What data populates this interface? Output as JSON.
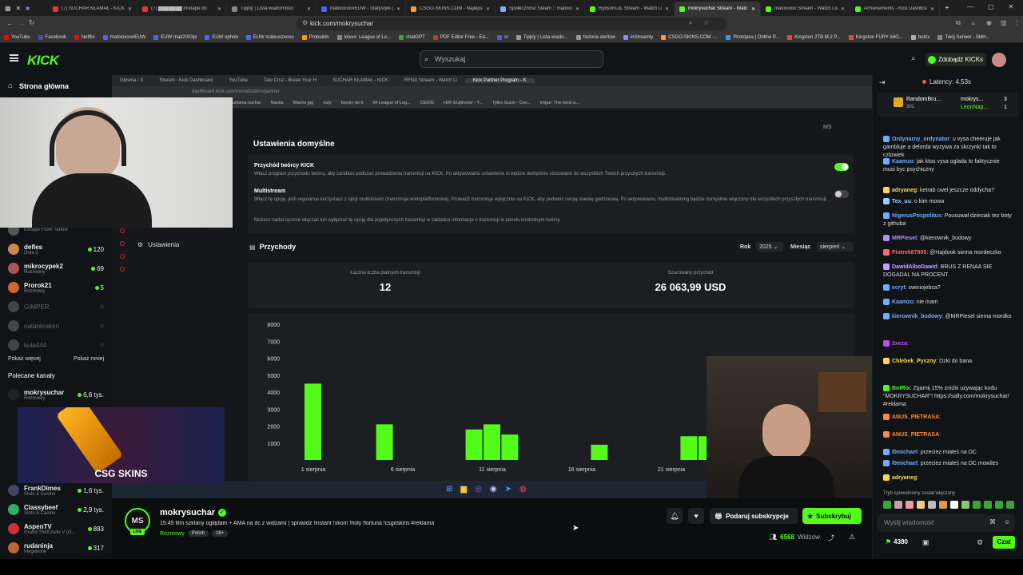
{
  "browser": {
    "tabs": [
      {
        "label": "(7) SUCHAR KŁAMAŁ - KICK PLAG",
        "color": "#e33"
      },
      {
        "label": "(7) ███████ mixtape do",
        "color": "#e33"
      },
      {
        "label": "Tipply | Lista wiadomości",
        "color": "#888"
      },
      {
        "label": "matixoxoo#EUW - Statystyki gry",
        "color": "#46f"
      },
      {
        "label": "CSGO-SKINS.COM - Najlepsze Si",
        "color": "#f93"
      },
      {
        "label": "Społeczność Steam :: matixoxo",
        "color": "#8af"
      },
      {
        "label": "RybsonLoL Stream - Watch Live",
        "color": "#53fc18"
      },
      {
        "label": "mokrysuchar Stream - Watc",
        "color": "#53fc18",
        "active": true
      },
      {
        "label": "matixoxoo Stream - Watch Live",
        "color": "#53fc18"
      },
      {
        "label": "Achievements - Kick Dashboard",
        "color": "#53fc18"
      }
    ],
    "url": "kick.com/mokrysuchar",
    "bookmarks": [
      "YouTube",
      "Facebook",
      "Netflix",
      "matixoxoo#EUW",
      "EUW mati2003pl",
      "EUW ophob",
      "EUW mateuszxoxo",
      "Probuilds",
      "lolvvv: League of Le...",
      "chatGPT",
      "PDF Editor Free - Ed...",
      "sr",
      "Tipply | Lista wiado...",
      "historia alertow",
      "inStreamly",
      "CSGO-SKINS.COM -...",
      "Photopea | Online P...",
      "Kingston 2TB M.2 P...",
      "Kingston FURY 64G...",
      "botrix",
      "Twój Serwer - SklH..."
    ]
  },
  "header": {
    "logo": "KICK",
    "search_placeholder": "Wyszukaj",
    "kicks_button": "Zdobądź KICKs"
  },
  "sidebar": {
    "home": "Strona główna",
    "following": [
      {
        "name": "Escape From Tarkov",
        "sub": "",
        "count": "",
        "color": "#555"
      },
      {
        "name": "defles",
        "sub": "Dota 2",
        "count": "120",
        "color": "#c84"
      },
      {
        "name": "mikrocypek2",
        "sub": "Rozmowy",
        "count": "69",
        "color": "#a55"
      },
      {
        "name": "Prorok21",
        "sub": "Rozmowy",
        "count": "5",
        "color": "#c63"
      },
      {
        "name": "GIMPER",
        "sub": "",
        "count": "",
        "color": "#444",
        "offline": true
      },
      {
        "name": "natankraken",
        "sub": "",
        "count": "",
        "color": "#444",
        "offline": true
      },
      {
        "name": "kula444",
        "sub": "",
        "count": "",
        "color": "#444",
        "offline": true
      }
    ],
    "show_more": "Pokaż więcej",
    "show_less": "Pokaż mniej",
    "recommended_title": "Polecane kanały",
    "recommended": [
      {
        "name": "mokrysuchar",
        "sub": "Rozmowy",
        "count": "6,6 tys.",
        "color": "#222"
      },
      {
        "name": "FrankDimes",
        "sub": "Slots & Casino",
        "count": "1,6 tys.",
        "color": "#446"
      },
      {
        "name": "Classybeef",
        "sub": "Slots & Casino",
        "count": "2,9 tys.",
        "color": "#3a6"
      },
      {
        "name": "AspenTV",
        "sub": "Grand Theft Auto V (G...",
        "count": "883",
        "color": "#c33"
      },
      {
        "name": "rudaninja",
        "sub": "Megabonk",
        "count": "317",
        "color": "#b63"
      }
    ]
  },
  "stream": {
    "inner_tabs": [
      "Główna / X",
      "Stream - Kick Dashboard",
      "YouTube",
      "Taio Cruz - Break Your H",
      "SUCHAR KŁAMAŁ - KICK",
      "RFNX Stream - Watch Li",
      "Kick Partner Program - K"
    ],
    "inner_url": "dashboard.kick.com/monetization/partner",
    "inner_bookmarks": [
      "nowesamochody",
      "samochody xayo",
      "iphone",
      "mieszkania suchar",
      "Nauka",
      "Ważne jpg",
      "nuty",
      "twesty do it",
      "94 League of Leg...",
      "CEIDG",
      "H2K EUphoria! - Y...",
      "Tylko Gucio - Cov...",
      "Imgur: The most a..."
    ],
    "side_menu": {
      "kanal": "Kanał",
      "ustawienia": "Ustawienia"
    },
    "default_settings": {
      "title": "Ustawienia domyślne",
      "creator_income_title": "Przychód twórcy KICK",
      "creator_income_desc": "Włącz program przychodu twórcy, aby zarabiać podczas prowadzenia transmisji na KICK. Po aktywowaniu ustawienie to będzie domyślnie stosowane do wszystkich Twoich przyszłych transmisji.",
      "multistream_title": "Multistream",
      "multistream_desc": "Włącz tę opcję, jeśli regularnie korzystasz z opcji multistream (transmisja wieloplatformowa). Prowadź transmisje wyłącznie na KICK, aby podwoić swoją stawkę godzinową. Po aktywowaniu, multistreaming będzie domyślnie włączony dla wszystkich przyszłych transmisji.",
      "note": "Możesz nadal ręcznie włączać lub wyłączać tę opcję dla pojedynczych transmisji w zakładce informacje o transmisji w panelu kontrolnym twórcy.",
      "creator_income_on": true,
      "multistream_on": false
    },
    "income": {
      "title": "Przychody",
      "year_label": "Rok",
      "year_value": "2025",
      "month_label": "Miesiąc",
      "month_value": "sierpień",
      "paid_label": "Łączna liczba płatnych transmisji",
      "paid_value": "12",
      "estimated_label": "Szacowany przychód",
      "estimated_value": "26 063,99 USD"
    },
    "overlay_brand": "CSG SKINS"
  },
  "chart_data": {
    "type": "bar",
    "y_ticks": [
      "1000",
      "2000",
      "3000",
      "4000",
      "5000",
      "6000",
      "7000",
      "8000"
    ],
    "ylim": [
      0,
      8000
    ],
    "x_labels": [
      "1 sierpnia",
      "6 sierpnia",
      "11 sierpnia",
      "16 sierpnia",
      "21 sierpnia"
    ],
    "x_label_days": [
      1,
      6,
      11,
      16,
      21
    ],
    "bars": [
      {
        "day": 1,
        "value": 4500
      },
      {
        "day": 5,
        "value": 2100
      },
      {
        "day": 10,
        "value": 1800
      },
      {
        "day": 11,
        "value": 2100
      },
      {
        "day": 12,
        "value": 1500
      },
      {
        "day": 17,
        "value": 900
      },
      {
        "day": 22,
        "value": 1400
      },
      {
        "day": 23,
        "value": 1400
      },
      {
        "day": 24,
        "value": 1250
      }
    ],
    "color": "#53fc18"
  },
  "info": {
    "avatar_initials": "MS",
    "live_badge": "LIVE",
    "channel": "mokrysuchar",
    "title": "15:45 film szklany oglądam + AMA na dc z widzami | sprawdź !instant !xkom !holy !fortuna !csgoskins #reklama",
    "category": "Rozmowy",
    "tags": [
      "Polish",
      "18+"
    ],
    "gift_button": "Podaruj subskrypcje",
    "subscribe_button": "Subskrybuj",
    "viewers": "6568",
    "viewers_label": "Widzów"
  },
  "chat": {
    "latency": "Latency: 4.53s",
    "leaderboard": [
      {
        "name": "RandomBru...",
        "sub": "301"
      },
      {
        "name": "mokrys...",
        "count": "3"
      },
      {
        "name": "LeonNap...",
        "count": "1"
      }
    ],
    "messages": [
      {
        "user": "Ordynarny_ordynator",
        "color": "#6ab0ff",
        "text": ": u vysa cheeruje jak gambluje a delorda wyzywa za skrzynki tak to czlowiek"
      },
      {
        "user": "Kaamzo",
        "color": "#6ab0ff",
        "text": ": jak ktos vysa oglada to faktycznie musi byc psychiczny"
      },
      {
        "user": "adryaneg",
        "color": "#ffd84a",
        "text": ": ketrab cwel jeszcze oddycha?"
      },
      {
        "user": "Tex_uu",
        "color": "#8fd3ff",
        "text": ": o kim mowa"
      },
      {
        "user": "NigerusPospolitus",
        "color": "#6ab0ff",
        "text": ": Pousuwał dzieciak tez boty z githuba"
      },
      {
        "user": "MRPiesel",
        "color": "#b48cff",
        "text": ": @kierownik_budowy"
      },
      {
        "user": "Piotrek87905",
        "color": "#ff6a6a",
        "text": ": @Hajdook siema mordeczko"
      },
      {
        "user": "DawidAlboDawid",
        "color": "#c9a0ff",
        "text": ": BRUS Z RENAA SIE DOGADAL NA PROCENT"
      },
      {
        "user": "ecryt",
        "color": "#6ab0ff",
        "text": ": swiniojebca?"
      },
      {
        "user": "Kaamzo",
        "color": "#6ab0ff",
        "text": ": nie mam"
      },
      {
        "user": "kierownik_budowy",
        "color": "#6ab0ff",
        "text": ": @MRPiesel siema mordko"
      },
      {
        "user": "3xeza",
        "color": "#c04aff",
        "text": ":"
      },
      {
        "user": "Chlebek_Pyszny",
        "color": "#ffd84a",
        "text": ": Dzki do bana"
      },
      {
        "user": "BotRix",
        "color": "#53fc18",
        "text": ": Zgarnij 15% zniżki używając kodu \"MOKRYSUCHAR\"! https://sally.com/mokrysuchar/ #reklama"
      },
      {
        "user": "ANUS_PIETRASA",
        "color": "#ff8a3a",
        "text": ":"
      },
      {
        "user": "ANUS_PIETRASA",
        "color": "#ff8a3a",
        "text": ":"
      },
      {
        "user": "l0michael",
        "color": "#6ab0ff",
        "text": ": przeciez mialeś na DC"
      },
      {
        "user": "l0michael",
        "color": "#6ab0ff",
        "text": ": przeciez mialeś na DC mowiles"
      },
      {
        "user": "adryaneg",
        "color": "#ffd84a",
        "text": ":"
      }
    ],
    "slow_mode": "Tryb spowolniony został włączony",
    "input_placeholder": "Wyślij wiadomość",
    "kicks_count": "4380",
    "chat_button": "Czat"
  }
}
